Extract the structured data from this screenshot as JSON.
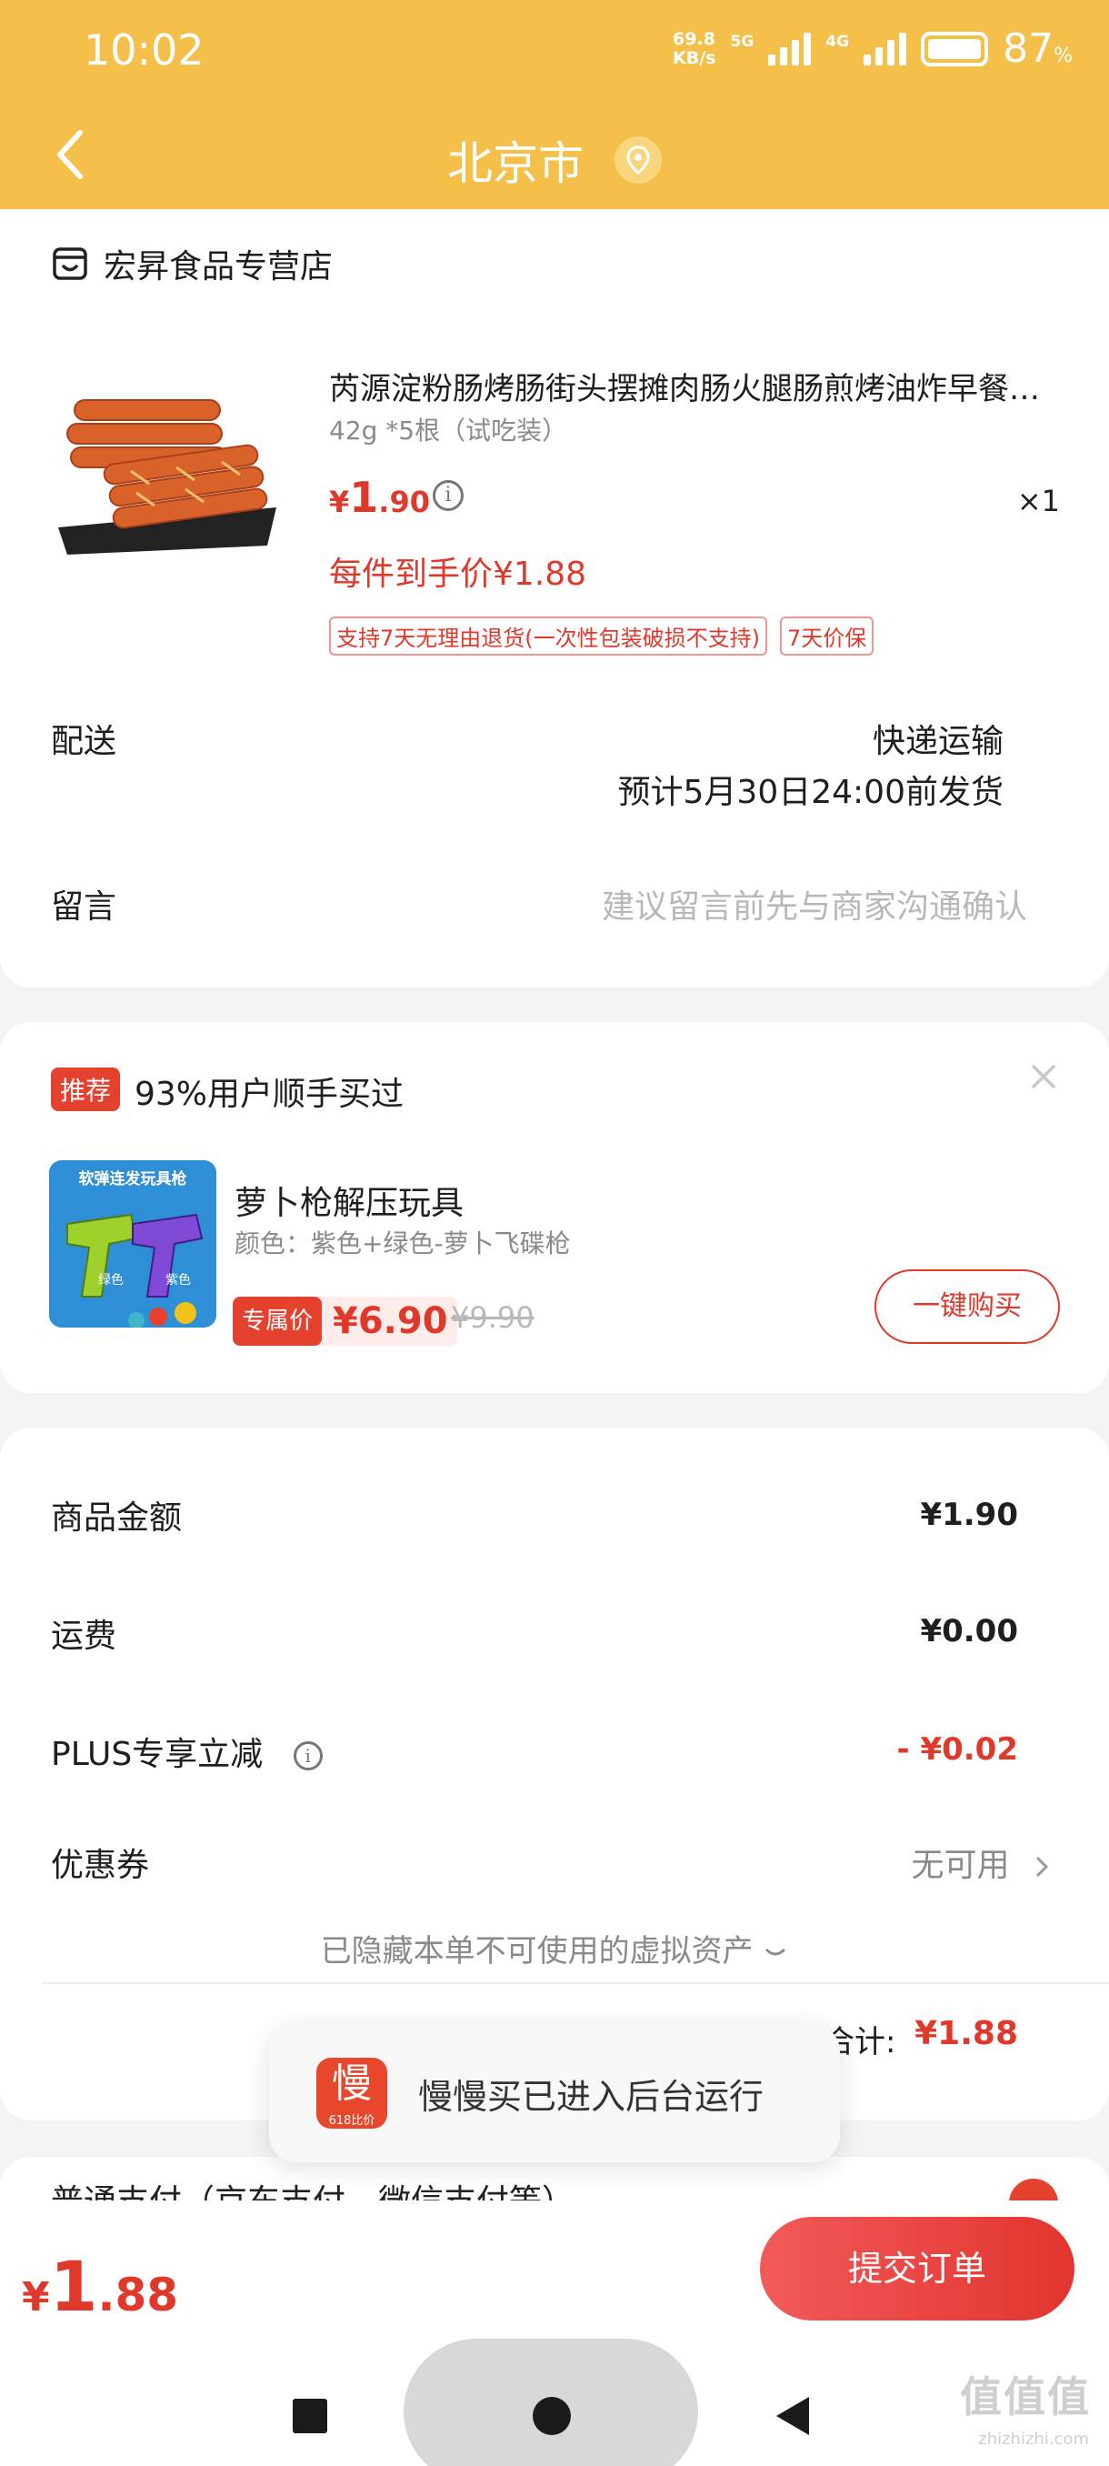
{
  "status_bar": {
    "time": "10:02",
    "net_speed_value": "69.8",
    "net_speed_unit": "KB/s",
    "signal1": "5G",
    "signal2": "4G",
    "battery": "87",
    "battery_unit": "%"
  },
  "header": {
    "title": "北京市",
    "icons": [
      "back-icon",
      "location-icon"
    ]
  },
  "order_item": {
    "shop_name": "宏昇食品专营店",
    "title": "芮源淀粉肠烤肠街头摆摊肉肠火腿肠煎烤油炸早餐香肠",
    "spec": "42g *5根（试吃装）",
    "price_currency": "¥",
    "price_int": "1",
    "price_dec": ".90",
    "qty": "×1",
    "per_piece_price": "每件到手价¥1.88",
    "tags": [
      "支持7天无理由退货(一次性包装破损不支持)",
      "7天价保"
    ]
  },
  "delivery": {
    "label": "配送",
    "method": "快递运输",
    "estimate": "预计5月30日24:00前发货"
  },
  "message": {
    "label": "留言",
    "placeholder": "建议留言前先与商家沟通确认"
  },
  "recommendation": {
    "badge": "推荐",
    "headline": "93%用户顺手买过",
    "image_text": "软弹连发玩具枪",
    "image_label_left": "绿色",
    "image_label_right": "紫色",
    "title": "萝卜枪解压玩具",
    "spec": "颜色：紫色+绿色-萝卜飞碟枪",
    "price_badge": "专属价",
    "price": "¥6.90",
    "original_price": "¥9.90",
    "buy_label": "一键购买"
  },
  "summary": {
    "rows": [
      {
        "label": "商品金额",
        "value": "¥1.90"
      },
      {
        "label": "运费",
        "value": "¥0.00"
      },
      {
        "label": "PLUS专享立减",
        "value": "- ¥0.02"
      },
      {
        "label": "优惠券",
        "value": "无可用"
      }
    ],
    "hidden_assets": "已隐藏本单不可使用的虚拟资产",
    "total_label": "合计:",
    "total_value": "¥1.88"
  },
  "toast": {
    "logo_char": "慢",
    "logo_sub": "618比价",
    "text": "慢慢买已进入后台运行"
  },
  "payment": {
    "text": "普通支付（京东支付、微信支付等）"
  },
  "bottom_bar": {
    "price_currency": "¥",
    "price_int": "1",
    "price_dec": ".88",
    "submit_label": "提交订单"
  },
  "watermark": {
    "text": "值值值",
    "sub": "zhizhizhi.com"
  },
  "colors": {
    "header_bg": "#f5c04a",
    "accent_red": "#e0392b",
    "page_bg": "#f4f4f4"
  }
}
